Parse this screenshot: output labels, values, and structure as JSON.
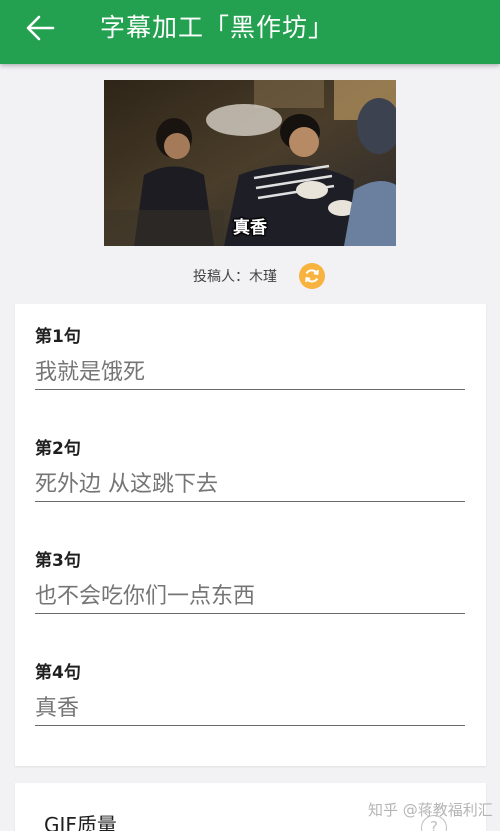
{
  "app_bar": {
    "title": "字幕加工「黑作坊」",
    "back_icon": "arrow-left-icon",
    "color": "#24a150"
  },
  "preview": {
    "caption": "真香"
  },
  "author": {
    "text": "投稿人：木瑾",
    "refresh_icon": "refresh-icon",
    "refresh_color": "#f7b23f"
  },
  "lines": [
    {
      "label": "第1句",
      "placeholder": "我就是饿死"
    },
    {
      "label": "第2句",
      "placeholder": "死外边 从这跳下去"
    },
    {
      "label": "第3句",
      "placeholder": "也不会吃你们一点东西"
    },
    {
      "label": "第4句",
      "placeholder": "真香"
    }
  ],
  "gif_quality": {
    "label": "GIF质量",
    "help_text": "?"
  },
  "watermark": "知乎 @蒋教福利汇"
}
